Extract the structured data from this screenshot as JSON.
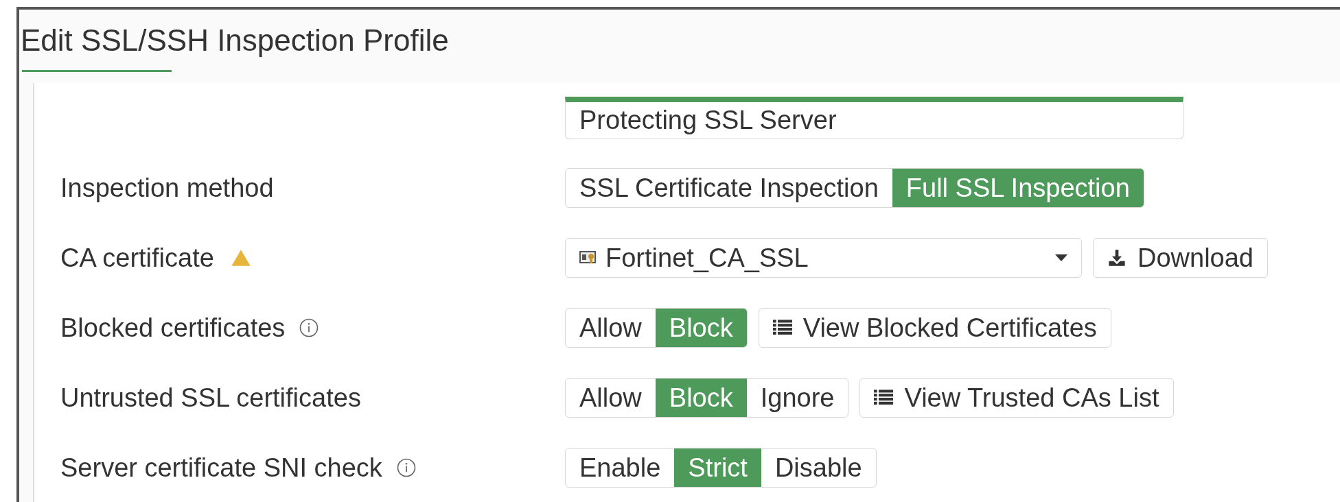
{
  "title": "Edit SSL/SSH Inspection Profile",
  "profile_name": {
    "value": "Protecting SSL Server"
  },
  "rows": [
    {
      "kind": "segmented",
      "label": "Inspection method",
      "info": false,
      "warning": false,
      "options": [
        {
          "label": "SSL Certificate Inspection",
          "selected": false
        },
        {
          "label": "Full SSL Inspection",
          "selected": true
        }
      ]
    },
    {
      "kind": "select",
      "label": "CA certificate",
      "info": false,
      "warning": true,
      "value": "Fortinet_CA_SSL",
      "button": {
        "label": "Download",
        "kind": "download"
      }
    },
    {
      "kind": "segmented",
      "label": "Blocked certificates",
      "info": true,
      "warning": false,
      "options": [
        {
          "label": "Allow",
          "selected": false
        },
        {
          "label": "Block",
          "selected": true
        }
      ],
      "button": {
        "label": "View Blocked Certificates",
        "kind": "list"
      }
    },
    {
      "kind": "segmented",
      "label": "Untrusted SSL certificates",
      "info": false,
      "warning": false,
      "options": [
        {
          "label": "Allow",
          "selected": false
        },
        {
          "label": "Block",
          "selected": true
        },
        {
          "label": "Ignore",
          "selected": false
        }
      ],
      "button": {
        "label": "View Trusted CAs List",
        "kind": "list"
      }
    },
    {
      "kind": "segmented",
      "label": "Server certificate SNI check",
      "info": true,
      "warning": false,
      "options": [
        {
          "label": "Enable",
          "selected": false
        },
        {
          "label": "Strict",
          "selected": true
        },
        {
          "label": "Disable",
          "selected": false
        }
      ]
    }
  ]
}
